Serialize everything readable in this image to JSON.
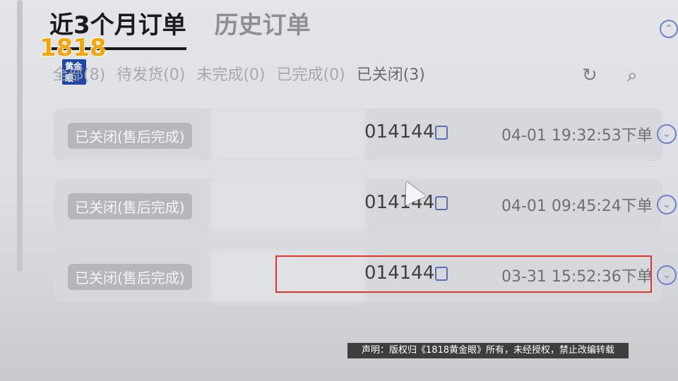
{
  "tabs": {
    "active": "近3个月订单",
    "inactive": "历史订单"
  },
  "filters": [
    {
      "label": "全部(8)"
    },
    {
      "label": "待发货(0)"
    },
    {
      "label": "未完成(0)"
    },
    {
      "label": "已完成(0)"
    },
    {
      "label": "已关闭(3)"
    }
  ],
  "toolbar": {
    "refresh_icon": "↻",
    "search_icon": "⌕"
  },
  "logo": {
    "number": "1818",
    "text": "黄金眼"
  },
  "orders": [
    {
      "status": "已关闭(售后完成)",
      "order_suffix": "014144",
      "time": "04-01 19:32:53下单"
    },
    {
      "status": "已关闭(售后完成)",
      "order_suffix": "014144",
      "time": "04-01 09:45:24下单"
    },
    {
      "status": "已关闭(售后完成)",
      "order_suffix": "014144",
      "time": "03-31 15:52:36下单"
    }
  ],
  "notice": "声明：版权归《1818黄金眼》所有，未经授权，禁止改编转载"
}
